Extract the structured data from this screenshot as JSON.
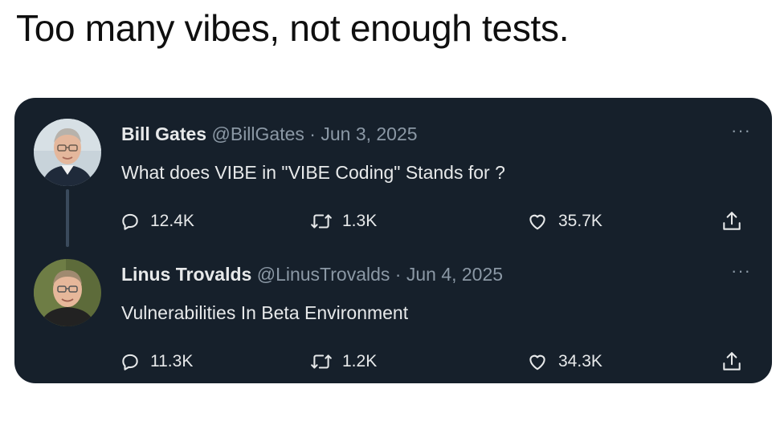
{
  "caption": "Too many vibes, not enough tests.",
  "tweets": [
    {
      "name": "Bill Gates",
      "handle": "@BillGates",
      "date": "Jun 3, 2025",
      "text": "What does VIBE in \"VIBE Coding\" Stands for ?",
      "replies": "12.4K",
      "retweets": "1.3K",
      "likes": "35.7K",
      "more": "···"
    },
    {
      "name": "Linus Trovalds",
      "handle": "@LinusTrovalds",
      "date": "Jun 4, 2025",
      "text": "Vulnerabilities In Beta Environment",
      "replies": "11.3K",
      "retweets": "1.2K",
      "likes": "34.3K",
      "more": "···"
    }
  ],
  "colors": {
    "card_bg": "#16202b",
    "text_primary": "#e7e9ea",
    "text_secondary": "#8b98a5"
  }
}
